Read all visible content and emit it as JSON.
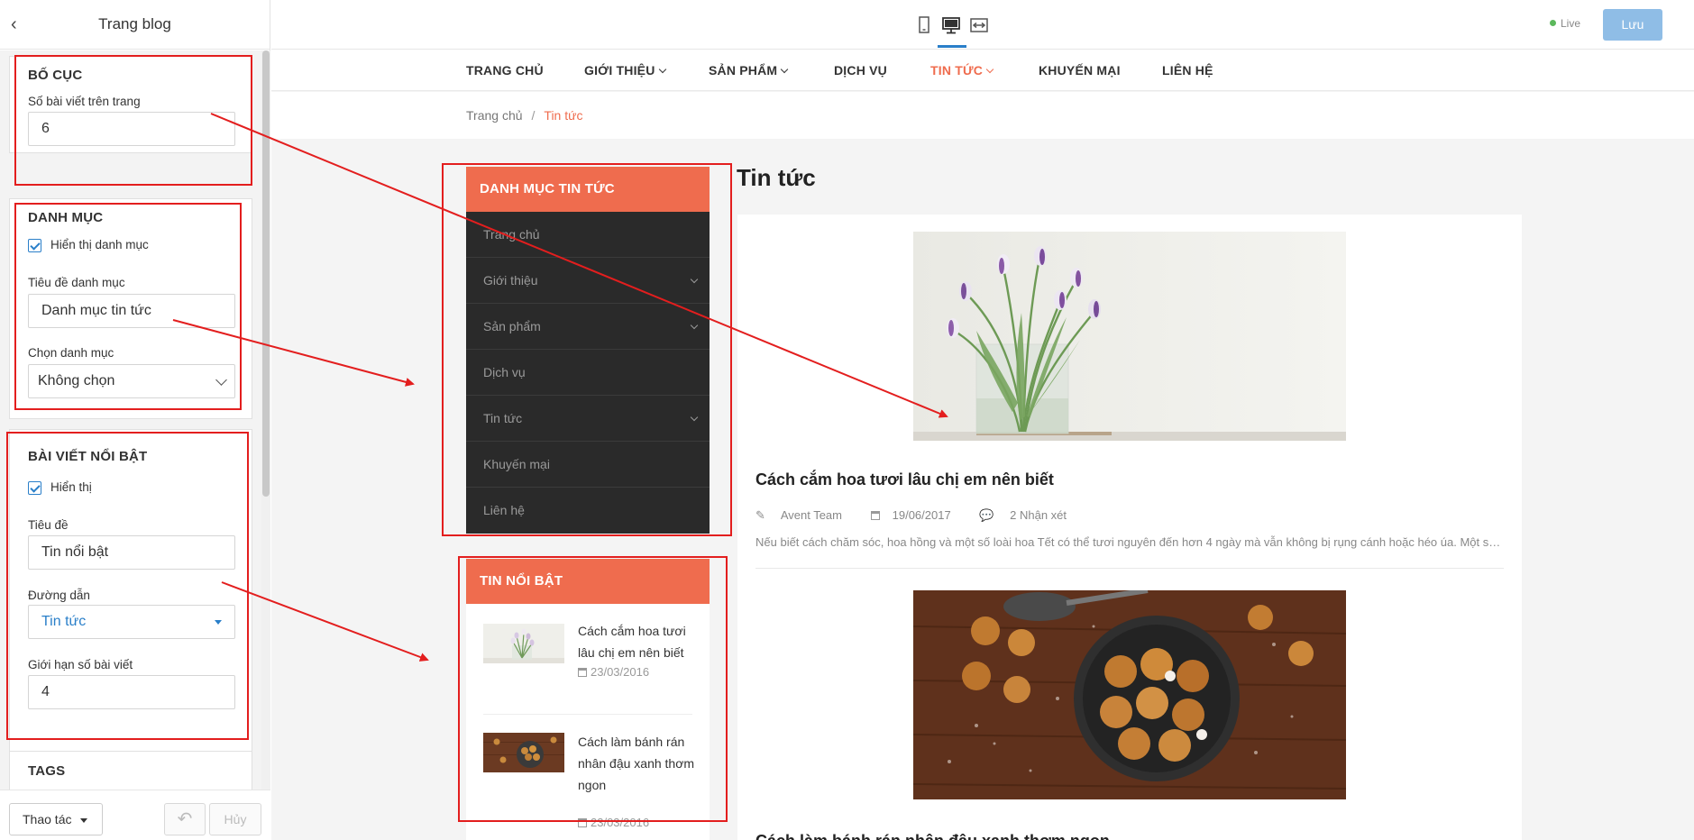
{
  "panel": {
    "title": "Trang blog",
    "layout": {
      "title": "BỐ CỤC",
      "posts_label": "Số bài viết trên trang",
      "posts_value": "6"
    },
    "category": {
      "title": "DANH MỤC",
      "show_label": "Hiển thị danh mục",
      "heading_label": "Tiêu đề danh mục",
      "heading_value": "Danh mục tin tức",
      "choose_label": "Chọn danh mục",
      "choose_value": "Không chọn"
    },
    "featured": {
      "title": "BÀI VIẾT NỔI BẬT",
      "show_label": "Hiển thị",
      "heading_label": "Tiêu đề",
      "heading_value": "Tin nổi bật",
      "link_label": "Đường dẫn",
      "link_value": "Tin tức",
      "limit_label": "Giới hạn số bài viết",
      "limit_value": "4"
    },
    "tags": {
      "title": "TAGS"
    },
    "footer": {
      "actions_label": "Thao tác",
      "cancel_label": "Hủy"
    }
  },
  "topbar": {
    "live_label": "Live",
    "save_label": "Lưu"
  },
  "nav": {
    "items": [
      {
        "label": "TRANG CHỦ"
      },
      {
        "label": "GIỚI THIỆU"
      },
      {
        "label": "SẢN PHẨM"
      },
      {
        "label": "DỊCH VỤ"
      },
      {
        "label": "TIN TỨC"
      },
      {
        "label": "KHUYẾN MẠI"
      },
      {
        "label": "LIÊN HỆ"
      }
    ]
  },
  "breadcrumb": {
    "home": "Trang chủ",
    "sep": "/",
    "current": "Tin tức"
  },
  "sidebar": {
    "categories_title": "DANH MỤC TIN TỨC",
    "categories": [
      {
        "label": "Trang chủ"
      },
      {
        "label": "Giới thiệu"
      },
      {
        "label": "Sản phẩm"
      },
      {
        "label": "Dịch vụ"
      },
      {
        "label": "Tin tức"
      },
      {
        "label": "Khuyến mại"
      },
      {
        "label": "Liên hệ"
      }
    ],
    "featured_title": "TIN NỔI BẬT",
    "featured": [
      {
        "title": "Cách cắm hoa tươi lâu chị em nên biết",
        "date": "23/03/2016"
      },
      {
        "title": "Cách làm bánh rán nhân đậu xanh thơm ngon",
        "date": "23/03/2016"
      }
    ]
  },
  "main": {
    "heading": "Tin tức",
    "posts": [
      {
        "title": "Cách cắm hoa tươi lâu chị em nên biết",
        "author": "Avent Team",
        "date": "19/06/2017",
        "comments": "2 Nhận xét",
        "excerpt": "Nếu biết cách chăm sóc, hoa hồng và một số loài hoa Tết có thể tươi nguyên đến hơn 4 ngày mà vẫn không bị rụng cánh hoặc héo úa. Một số..."
      },
      {
        "title": "Cách làm bánh rán nhân đậu xanh thơm ngon"
      }
    ]
  },
  "colors": {
    "accent": "#ef6c4e",
    "annotation": "#e31e1e",
    "primary": "#2a7fc9",
    "dark": "#2a2a2a"
  }
}
